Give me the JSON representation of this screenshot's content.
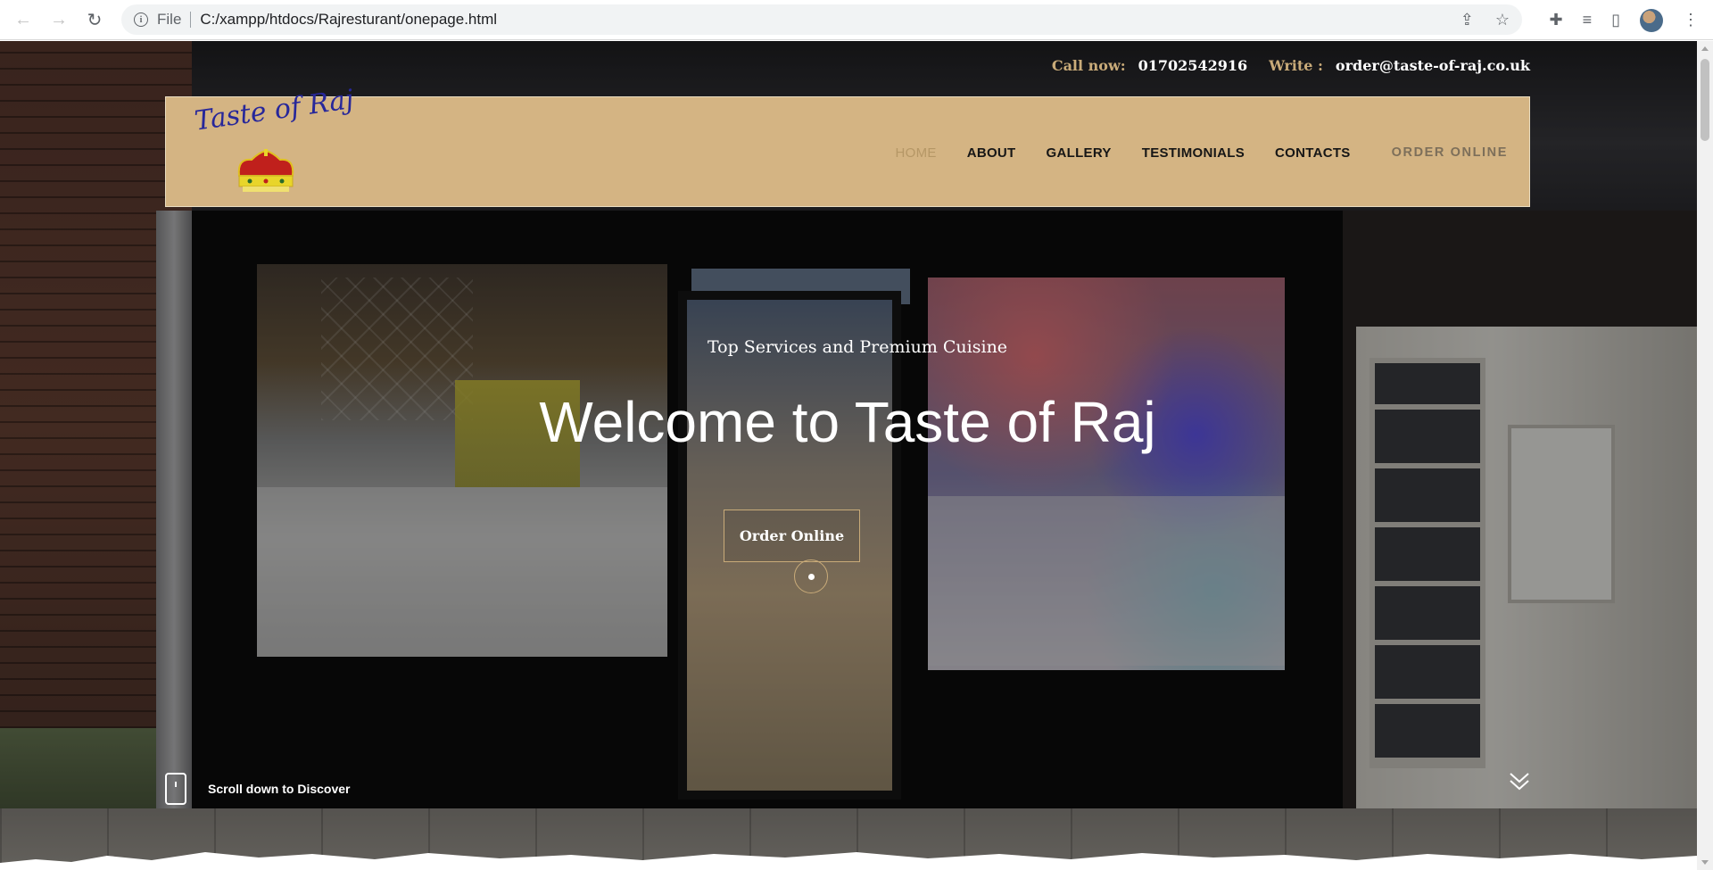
{
  "browser": {
    "scheme_label": "File",
    "url": "C:/xampp/htdocs/Rajresturant/onepage.html"
  },
  "topbar": {
    "call_label": "Call now:",
    "phone": "01702542916",
    "write_label": "Write :",
    "email": "order@taste-of-raj.co.uk"
  },
  "header": {
    "logo_text": "Taste of Raj",
    "menu": [
      {
        "label": "HOME",
        "active": true
      },
      {
        "label": "ABOUT",
        "active": false
      },
      {
        "label": "GALLERY",
        "active": false
      },
      {
        "label": "TESTIMONIALS",
        "active": false
      },
      {
        "label": "CONTACTS",
        "active": false
      },
      {
        "label": "ORDER ONLINE",
        "active": false
      }
    ]
  },
  "hero": {
    "subtitle": "Top Services and Premium Cuisine",
    "title": "Welcome to Taste of Raj",
    "button_label": "Order Online",
    "scroll_hint": "Scroll down to Discover"
  },
  "icons": {
    "back": "arrow-left-icon",
    "forward": "arrow-right-icon",
    "reload": "reload-icon",
    "info": "info-icon",
    "share": "share-icon",
    "bookmark": "star-icon",
    "extensions": "puzzle-icon",
    "media": "media-queue-icon",
    "sidepanel": "side-panel-icon",
    "menu": "kebab-menu-icon",
    "mouse": "mouse-icon",
    "scroll": "double-chevron-down-icon"
  },
  "colors": {
    "accent_gold": "#c9ab79",
    "header_bg": "#d4b483",
    "logo_blue": "#27279a",
    "text_dark": "#161616"
  }
}
